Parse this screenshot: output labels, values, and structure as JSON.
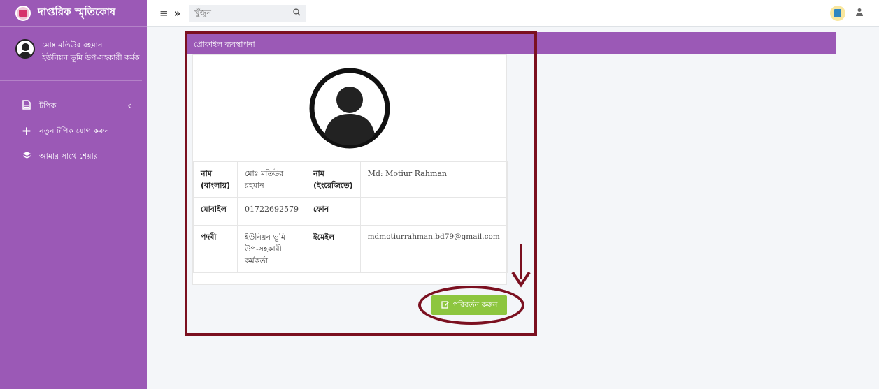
{
  "brand": {
    "title": "দাপ্তরিক স্মৃতিকোষ"
  },
  "user": {
    "name": "মোঃ মতিউর রহমান",
    "designation": "ইউনিয়ন ভূমি উপ-সহকারী কর্মক"
  },
  "sidebar": {
    "items": [
      {
        "label": "টপিক",
        "icon": "file-icon"
      },
      {
        "label": "নতুন টপিক যোগ করুন",
        "icon": "plus-icon"
      },
      {
        "label": "আমার সাথে শেয়ার",
        "icon": "layers-icon"
      }
    ]
  },
  "topbar": {
    "search_placeholder": "খুঁজুন"
  },
  "profile": {
    "header": "প্রোফাইল ব্যবস্থাপনা",
    "rows": [
      {
        "l1": "নাম (বাংলায়)",
        "v1": "মোঃ মতিউর রহমান",
        "l2": "নাম (ইংরেজিতে)",
        "v2": "Md: Motiur Rahman"
      },
      {
        "l1": "মোবাইল",
        "v1": "01722692579",
        "l2": "ফোন",
        "v2": ""
      },
      {
        "l1": "পদবী",
        "v1": "ইউনিয়ন ভূমি উপ-সহকারী কর্মকর্তা",
        "l2": "ইমেইল",
        "v2": "mdmotiurrahman.bd79@gmail.com"
      }
    ],
    "edit_button": "পরিবর্তন করুন"
  },
  "colors": {
    "sidebar": "#9b59b6",
    "edit_button": "#8dc63f",
    "annotation": "#7b1020"
  }
}
